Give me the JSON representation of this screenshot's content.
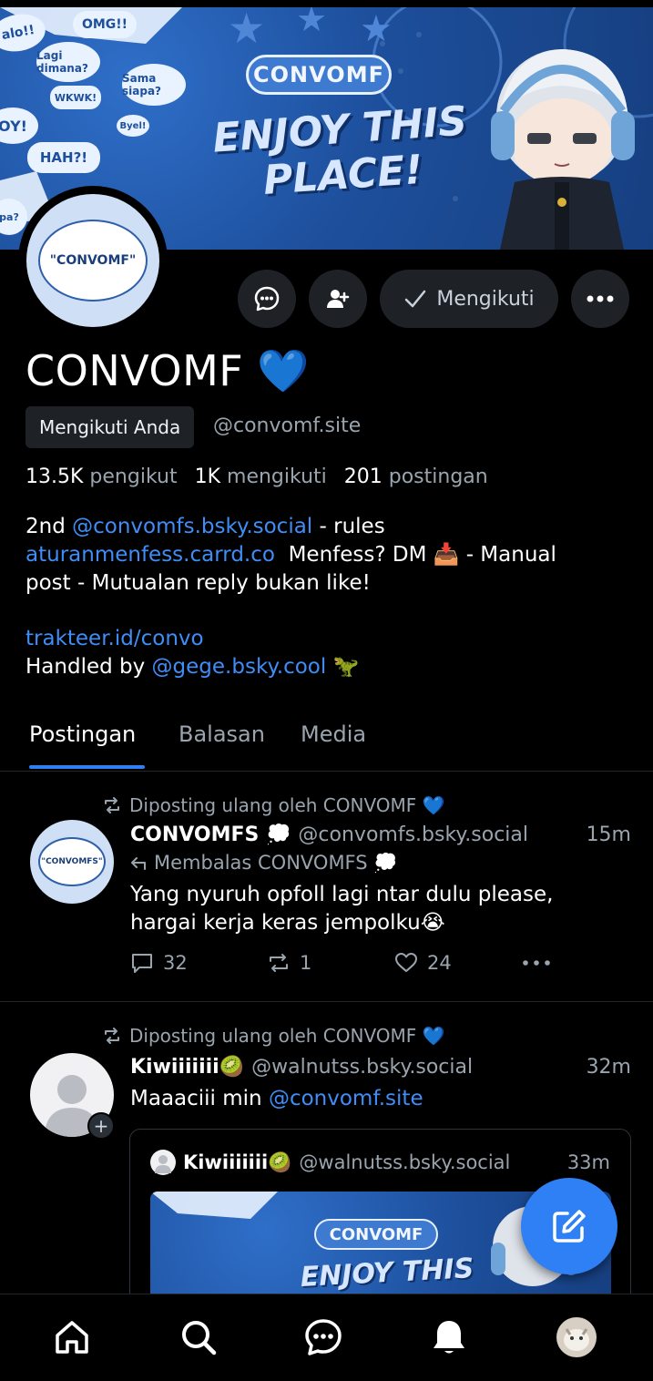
{
  "banner": {
    "title_top": "CONVOMF",
    "title_main": "ENJOY THIS PLACE!",
    "doodles": [
      "alo!!",
      "OMG!!",
      "Lagi dimana?",
      "Sama siapa?",
      "OY!",
      "WKWK!",
      "HAH?!",
      "Byel!",
      "pa?"
    ]
  },
  "profile": {
    "avatar_text": "\"CONVOMF\"",
    "display_name": "CONVOMF",
    "name_emoji": "💙",
    "follows_you_badge": "Mengikuti Anda",
    "handle": "@convomf.site",
    "follow_button": "Mengikuti",
    "stats": {
      "followers_count": "13.5K",
      "followers_label": "pengikut",
      "following_count": "1K",
      "following_label": "mengikuti",
      "posts_count": "201",
      "posts_label": "postingan"
    },
    "bio": {
      "line1_prefix": "2nd ",
      "line1_link": "@convomfs.bsky.social",
      "line1_suffix": " - rules",
      "line2_link": "aturanmenfess.carrd.co",
      "line2_suffix": "  Menfess? DM 📥 - Manual",
      "line3": "post - Mutualan reply bukan like!",
      "link3": "trakteer.id/convo",
      "line5_prefix": "Handled by ",
      "line5_link": "@gege.bsky.cool",
      "line5_emoji": " 🦖"
    }
  },
  "tabs": [
    {
      "label": "Postingan",
      "active": true
    },
    {
      "label": "Balasan",
      "active": false
    },
    {
      "label": "Media",
      "active": false
    }
  ],
  "posts": [
    {
      "repost_label": "Diposting ulang oleh CONVOMF 💙",
      "author": "CONVOMFS 💭",
      "handle": "@convomfs.bsky.social",
      "time": "15m",
      "avatar_text": "\"CONVOMFS\"",
      "reply_to": "Membalas CONVOMFS 💭",
      "text_line1": "Yang nyuruh opfoll lagi ntar dulu please,",
      "text_line2": "hargai kerja keras jempolku😭",
      "replies": "32",
      "reposts": "1",
      "likes": "24"
    },
    {
      "repost_label": "Diposting ulang oleh CONVOMF 💙",
      "author": "Kiwiiiiiii🥝",
      "handle": "@walnutss.bsky.social",
      "time": "32m",
      "text_prefix": "Maaaciii min ",
      "text_link": "@convomf.site",
      "quote": {
        "author": "Kiwiiiiiii🥝",
        "handle": "@walnutss.bsky.social",
        "time": "33m",
        "image_title_top": "CONVOMF",
        "image_title_main": "ENJOY THIS"
      }
    }
  ],
  "colors": {
    "accent": "#2f7ff5",
    "link": "#3f8df6",
    "muted": "#9aa4af",
    "surface": "#1e2227",
    "background": "#000000"
  },
  "icons": {
    "message": "chat-bubble-dots-icon",
    "follow": "user-plus-icon",
    "more": "more-horizontal-icon",
    "check": "check-icon",
    "repost": "repost-icon",
    "reply": "reply-arrow-icon",
    "comment": "comment-icon",
    "like": "heart-icon",
    "compose": "compose-pencil-icon",
    "nav": [
      "home-icon",
      "search-icon",
      "chat-icon",
      "bell-icon",
      "profile-avatar"
    ]
  }
}
